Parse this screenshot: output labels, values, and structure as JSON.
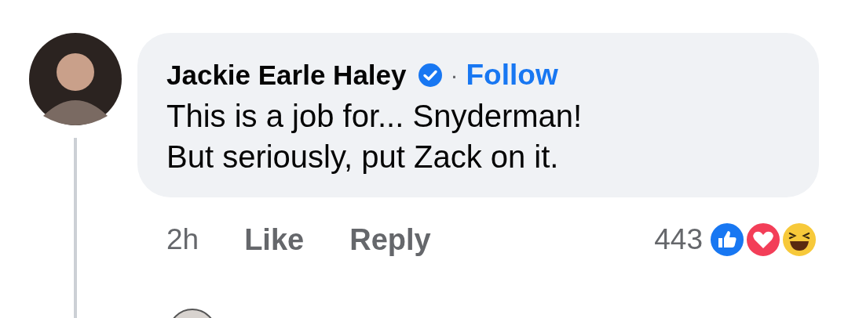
{
  "comment": {
    "author": "Jackie Earle Haley",
    "verified": true,
    "separator": "·",
    "follow": "Follow",
    "lines": [
      "This is a job for... Snyderman!",
      "But seriously, put Zack on it."
    ],
    "time": "2h",
    "actions": [
      "Like",
      "Reply"
    ],
    "reaction_count": "443",
    "reactions": [
      {
        "kind": "like"
      },
      {
        "kind": "love"
      },
      {
        "kind": "haha"
      }
    ]
  }
}
